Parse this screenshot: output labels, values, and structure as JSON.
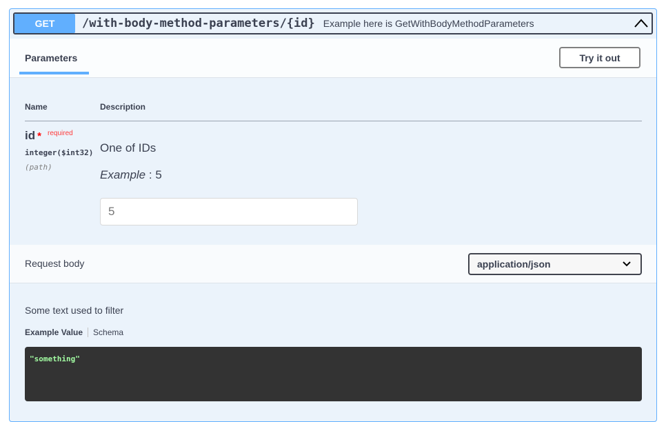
{
  "summary": {
    "method": "GET",
    "path": "/with-body-method-parameters/{id}",
    "description": "Example here is GetWithBodyMethodParameters",
    "icon": "chevron-up-icon"
  },
  "tabs": {
    "parameters_label": "Parameters",
    "try_button": "Try it out"
  },
  "params_table": {
    "headers": {
      "name": "Name",
      "description": "Description"
    },
    "rows": [
      {
        "name": "id",
        "required_mark": "*",
        "required_label": "required",
        "type": "integer($int32)",
        "in": "(path)",
        "description": "One of IDs",
        "example_label": "Example",
        "example_value": ": 5",
        "input_value": "5"
      }
    ]
  },
  "request_body": {
    "title": "Request body",
    "content_type": "application/json",
    "description": "Some text used to filter",
    "example_tab": "Example Value",
    "schema_tab": "Schema",
    "example_code": "\"something\""
  },
  "colors": {
    "get_accent": "#61affe",
    "panel_bg": "#ebf3fb",
    "code_bg": "#333333",
    "code_text": "#a2fca2",
    "required": "#ff3b3b"
  }
}
